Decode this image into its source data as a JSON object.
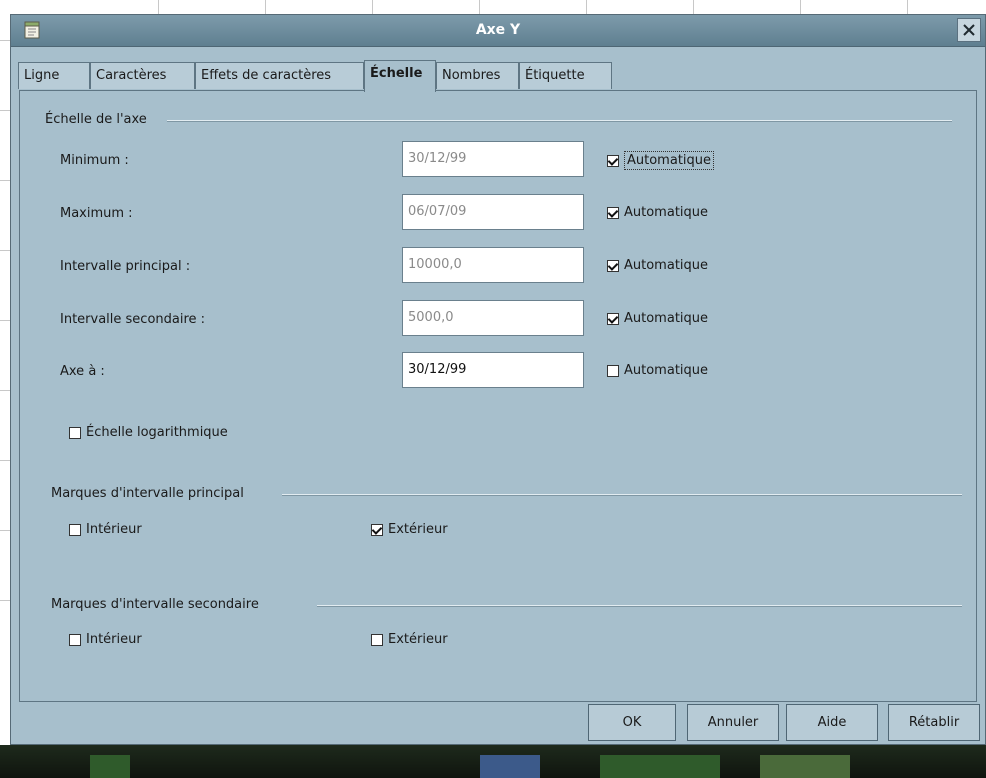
{
  "dialog": {
    "title": "Axe Y"
  },
  "tabs": [
    {
      "label": "Ligne"
    },
    {
      "label": "Caractères"
    },
    {
      "label": "Effets de caractères"
    },
    {
      "label": "Échelle"
    },
    {
      "label": "Nombres"
    },
    {
      "label": "Étiquette"
    }
  ],
  "active_tab": "Échelle",
  "axis_scale": {
    "group_label": "Échelle de l'axe",
    "fields": [
      {
        "label": "Minimum :",
        "value": "30/12/99",
        "auto_label": "Automatique",
        "auto": true,
        "enabled": false
      },
      {
        "label": "Maximum :",
        "value": "06/07/09",
        "auto_label": "Automatique",
        "auto": true,
        "enabled": false
      },
      {
        "label": "Intervalle principal :",
        "value": "10000,0",
        "auto_label": "Automatique",
        "auto": true,
        "enabled": false
      },
      {
        "label": "Intervalle secondaire :",
        "value": "5000,0",
        "auto_label": "Automatique",
        "auto": true,
        "enabled": false
      },
      {
        "label": "Axe à :",
        "value": "30/12/99",
        "auto_label": "Automatique",
        "auto": false,
        "enabled": true
      }
    ],
    "log_scale": {
      "label": "Échelle logarithmique",
      "checked": false
    }
  },
  "major_ticks": {
    "group_label": "Marques d'intervalle principal",
    "inner": {
      "label": "Intérieur",
      "checked": false
    },
    "outer": {
      "label": "Extérieur",
      "checked": true
    }
  },
  "minor_ticks": {
    "group_label": "Marques d'intervalle secondaire",
    "inner": {
      "label": "Intérieur",
      "checked": false
    },
    "outer": {
      "label": "Extérieur",
      "checked": false
    }
  },
  "buttons": {
    "ok": "OK",
    "cancel": "Annuler",
    "help": "Aide",
    "reset": "Rétablir"
  },
  "colors": {
    "dialog_bg": "#a7bfcc",
    "titlebar": "#6a8899",
    "title_text": "#ffffff"
  }
}
